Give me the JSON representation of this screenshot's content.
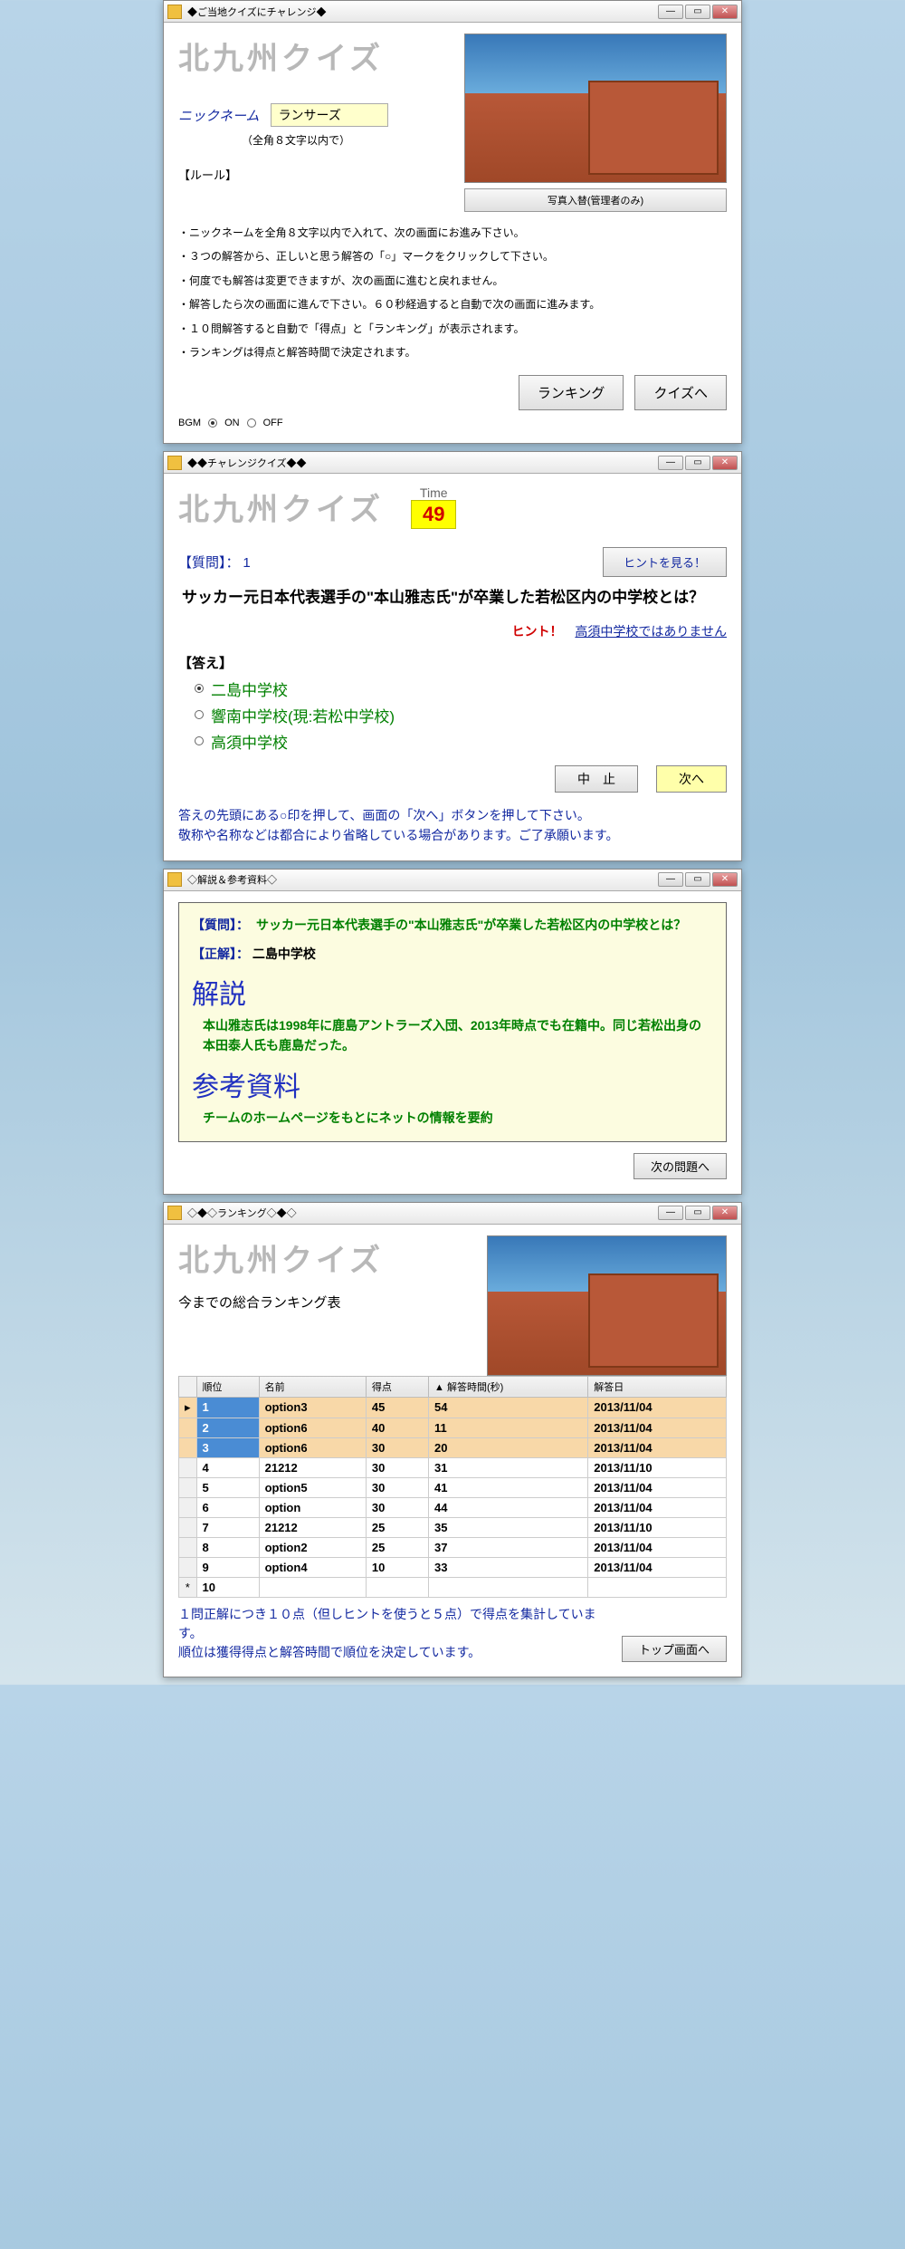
{
  "win1": {
    "title": "◆ご当地クイズにチャレンジ◆",
    "logo": "北九州クイズ",
    "nick_label": "ニックネーム",
    "nick_value": "ランサーズ",
    "nick_hint": "（全角８文字以内で）",
    "rules_title": "【ルール】",
    "rules": [
      "・ニックネームを全角８文字以内で入れて、次の画面にお進み下さい。",
      "・３つの解答から、正しいと思う解答の「○」マークをクリックして下さい。",
      "・何度でも解答は変更できますが、次の画面に進むと戻れません。",
      "・解答したら次の画面に進んで下さい。６０秒経過すると自動で次の画面に進みます。",
      "・１０問解答すると自動で「得点」と「ランキング」が表示されます。",
      "・ランキングは得点と解答時間で決定されます。"
    ],
    "photo_btn": "写真入替(管理者のみ)",
    "ranking_btn": "ランキング",
    "quiz_btn": "クイズへ",
    "bgm_label": "BGM",
    "bgm_on": "ON",
    "bgm_off": "OFF"
  },
  "win2": {
    "title": "◆◆チャレンジクイズ◆◆",
    "logo": "北九州クイズ",
    "time_label": "Time",
    "time_value": "49",
    "q_label": "【質問】：",
    "q_no": "1",
    "hint_btn": "ヒントを見る！",
    "question": "サッカー元日本代表選手の\"本山雅志氏\"が卒業した若松区内の中学校とは？",
    "hint_label": "ヒント！",
    "hint_text": "高須中学校ではありません",
    "answers_title": "【答え】",
    "answers": [
      "二島中学校",
      "響南中学校(現:若松中学校)",
      "高須中学校"
    ],
    "stop_btn": "中　止",
    "next_btn": "次へ",
    "foot1": "答えの先頭にある○印を押して、画面の「次へ」ボタンを押して下さい。",
    "foot2": "敬称や名称などは都合により省略している場合があります。ご了承願います。"
  },
  "win3": {
    "title": "◇解説＆参考資料◇",
    "q_label": "【質問】：",
    "q_text": "サッカー元日本代表選手の\"本山雅志氏\"が卒業した若松区内の中学校とは？",
    "a_label": "【正解】：",
    "a_text": "二島中学校",
    "exp_h": "解説",
    "exp_body": "本山雅志氏は1998年に鹿島アントラーズ入団、2013年時点でも在籍中。同じ若松出身の本田泰人氏も鹿島だった。",
    "ref_h": "参考資料",
    "ref_body": "チームのホームページをもとにネットの情報を要約",
    "next_btn": "次の問題へ"
  },
  "win4": {
    "title": "◇◆◇ランキング◇◆◇",
    "logo": "北九州クイズ",
    "rank_title": "今までの総合ランキング表",
    "cols": [
      "順位",
      "名前",
      "得点",
      "解答時間(秒)",
      "解答日"
    ],
    "rows": [
      {
        "hl": true,
        "ord": "1",
        "name": "option3",
        "score": "45",
        "time": "54",
        "date": "2013/11/04"
      },
      {
        "hl": true,
        "ord": "2",
        "name": "option6",
        "score": "40",
        "time": "11",
        "date": "2013/11/04"
      },
      {
        "hl": true,
        "ord": "3",
        "name": "option6",
        "score": "30",
        "time": "20",
        "date": "2013/11/04"
      },
      {
        "hl": false,
        "ord": "4",
        "name": "21212",
        "score": "30",
        "time": "31",
        "date": "2013/11/10"
      },
      {
        "hl": false,
        "ord": "5",
        "name": "option5",
        "score": "30",
        "time": "41",
        "date": "2013/11/04"
      },
      {
        "hl": false,
        "ord": "6",
        "name": "option",
        "score": "30",
        "time": "44",
        "date": "2013/11/04"
      },
      {
        "hl": false,
        "ord": "7",
        "name": "21212",
        "score": "25",
        "time": "35",
        "date": "2013/11/10"
      },
      {
        "hl": false,
        "ord": "8",
        "name": "option2",
        "score": "25",
        "time": "37",
        "date": "2013/11/04"
      },
      {
        "hl": false,
        "ord": "9",
        "name": "option4",
        "score": "10",
        "time": "33",
        "date": "2013/11/04"
      },
      {
        "hl": false,
        "ord": "10",
        "name": "",
        "score": "",
        "time": "",
        "date": ""
      }
    ],
    "note1": "１問正解につき１０点（但しヒントを使うと５点）で得点を集計しています。",
    "note2": "順位は獲得得点と解答時間で順位を決定しています。",
    "top_btn": "トップ画面へ"
  }
}
